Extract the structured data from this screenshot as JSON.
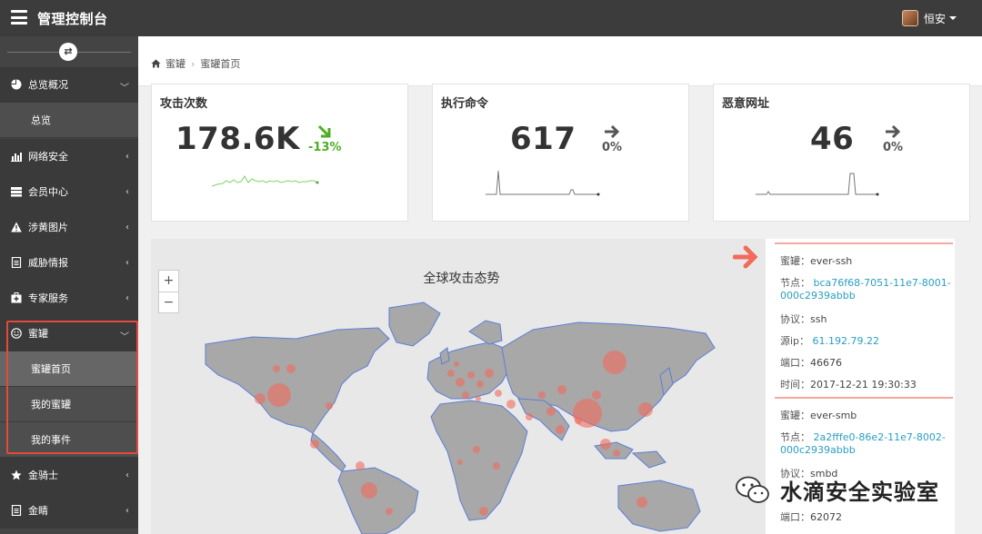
{
  "topbar": {
    "title": "管理控制台",
    "user": "恒安"
  },
  "sidebar": {
    "toggle_icon": "⇄",
    "items": [
      {
        "label": "总览概况",
        "icon": "pie-chart-icon"
      },
      {
        "label": "总览"
      },
      {
        "label": "网络安全",
        "icon": "bar-chart-icon"
      },
      {
        "label": "会员中心",
        "icon": "server-icon"
      },
      {
        "label": "涉黄图片",
        "icon": "warning-icon"
      },
      {
        "label": "威胁情报",
        "icon": "document-icon"
      },
      {
        "label": "专家服务",
        "icon": "medkit-icon"
      },
      {
        "label": "蜜罐",
        "icon": "smile-icon"
      },
      {
        "label": "蜜罐首页"
      },
      {
        "label": "我的蜜罐"
      },
      {
        "label": "我的事件"
      },
      {
        "label": "金骑士",
        "icon": "star-icon"
      },
      {
        "label": "金睛",
        "icon": "document-icon"
      }
    ]
  },
  "breadcrumb": {
    "root": "蜜罐",
    "current": "蜜罐首页"
  },
  "cards": [
    {
      "label": "攻击次数",
      "value": "178.6K",
      "change": "-13%",
      "trend": "down"
    },
    {
      "label": "执行命令",
      "value": "617",
      "change": "0%",
      "trend": "flat"
    },
    {
      "label": "恶意网址",
      "value": "46",
      "change": "0%",
      "trend": "flat"
    }
  ],
  "map": {
    "title": "全球攻击态势",
    "zoom_in": "+",
    "zoom_out": "−"
  },
  "events": [
    {
      "honeypot_label": "蜜罐：",
      "honeypot": "ever-ssh",
      "node_label": "节点：",
      "node_line1": "bca76f68-7051-11e7-8001-",
      "node_line2": "000c2939abbb",
      "protocol_label": "协议：",
      "protocol": "ssh",
      "ip_label": "源ip：",
      "ip": "61.192.79.22",
      "port_label": "端口：",
      "port": "46676",
      "time_label": "时间：",
      "time": "2017-12-21 19:30:33"
    },
    {
      "honeypot_label": "蜜罐：",
      "honeypot": "ever-smb",
      "node_label": "节点：",
      "node_line1": "2a2fffe0-86e2-11e7-8002-",
      "node_line2": "000c2939abbb",
      "protocol_label": "协议：",
      "protocol": "smbd",
      "port_label": "端口：",
      "port": "62072"
    }
  ],
  "watermark": "水滴安全实验室",
  "colors": {
    "topbar": "#3c3c3c",
    "sidebar": "#444444",
    "positive": "#4caf22",
    "link": "#2a9ec2",
    "highlight": "#e4493c",
    "hotspot": "#f26b5b",
    "land": "#a8a8a8"
  }
}
